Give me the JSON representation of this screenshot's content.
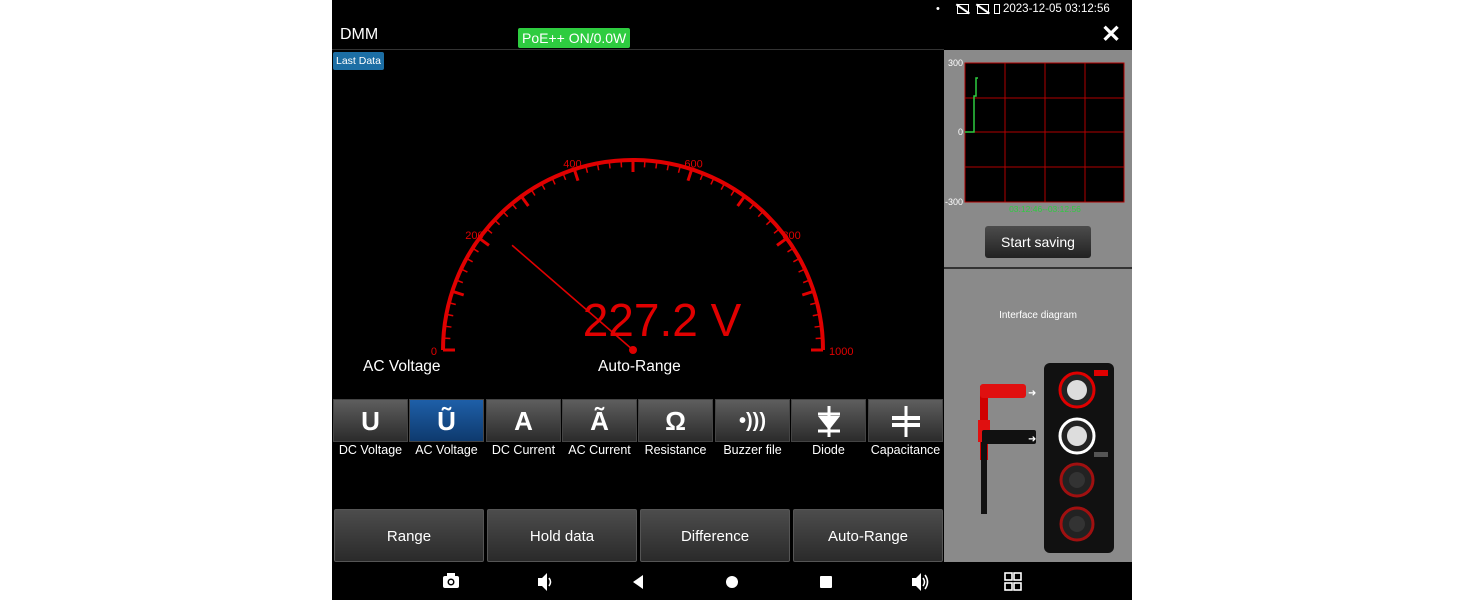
{
  "status_bar": {
    "dot": "•",
    "icons": [
      "no-signal-icon",
      "no-signal-icon",
      "battery-icon"
    ],
    "datetime": "2023-12-05 03:12:56"
  },
  "header": {
    "title": "DMM",
    "poe_status": "PoE++ ON/0.0W"
  },
  "last_data_label": "Last Data",
  "gauge": {
    "reading": "227.2",
    "unit": "V",
    "value": 227.2,
    "min": 0,
    "max": 1000,
    "tick_labels": [
      "0",
      "200",
      "400",
      "600",
      "800",
      "1000"
    ],
    "mode_label": "AC Voltage",
    "range_label": "Auto-Range",
    "color": "#e00000"
  },
  "functions": [
    {
      "symbol": "U",
      "label": "DC Voltage",
      "active": false
    },
    {
      "symbol": "Ũ",
      "label": "AC Voltage",
      "active": true
    },
    {
      "symbol": "A",
      "label": "DC Current",
      "active": false
    },
    {
      "symbol": "Ã",
      "label": "AC Current",
      "active": false
    },
    {
      "symbol": "Ω",
      "label": "Resistance",
      "active": false
    },
    {
      "symbol": "•)))",
      "label": "Buzzer file",
      "active": false
    },
    {
      "symbol": "diode-icon",
      "label": "Diode",
      "active": false
    },
    {
      "symbol": "capacitor-icon",
      "label": "Capacitance",
      "active": false
    }
  ],
  "actions": [
    "Range",
    "Hold data",
    "Difference",
    "Auto-Range"
  ],
  "trend": {
    "y_ticks": [
      "300",
      "0",
      "-300"
    ],
    "time_range": "03:12:46--03:12:56",
    "grid_color": "#b00000",
    "line_color": "#2ecc40"
  },
  "start_saving_label": "Start saving",
  "interface_diagram_title": "Interface diagram",
  "nav_icons": [
    "camera-icon",
    "volume-down-icon",
    "back-icon",
    "home-icon",
    "recents-icon",
    "volume-up-icon",
    "apps-grid-icon"
  ]
}
